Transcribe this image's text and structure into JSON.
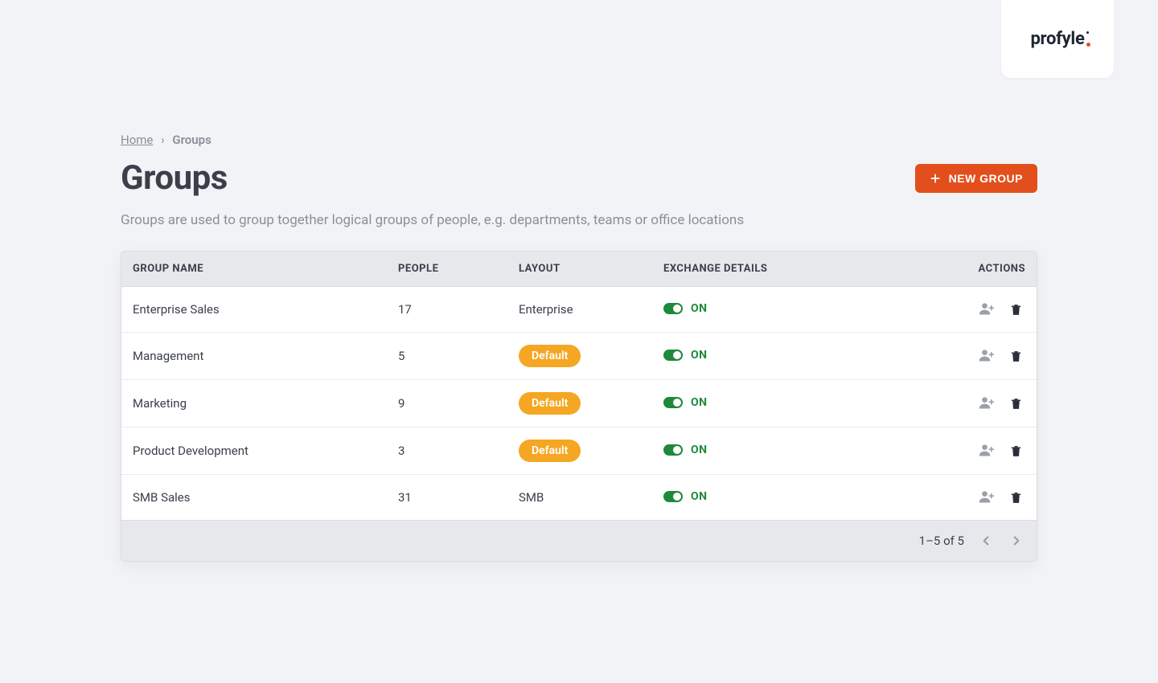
{
  "brand": {
    "name": "profyle"
  },
  "breadcrumb": {
    "home": "Home",
    "separator": "›",
    "current": "Groups"
  },
  "page": {
    "title": "Groups",
    "subtitle": "Groups are used to group together logical groups of people, e.g. departments, teams or office locations"
  },
  "buttons": {
    "new_group": "NEW GROUP"
  },
  "table": {
    "headers": {
      "name": "GROUP NAME",
      "people": "PEOPLE",
      "layout": "LAYOUT",
      "exchange": "EXCHANGE DETAILS",
      "actions": "ACTIONS"
    },
    "default_pill": "Default",
    "exchange_on": "ON",
    "rows": [
      {
        "name": "Enterprise Sales",
        "people": "17",
        "layout": "Enterprise",
        "layout_is_default": false,
        "exchange_on": true
      },
      {
        "name": "Management",
        "people": "5",
        "layout": "Default",
        "layout_is_default": true,
        "exchange_on": true
      },
      {
        "name": "Marketing",
        "people": "9",
        "layout": "Default",
        "layout_is_default": true,
        "exchange_on": true
      },
      {
        "name": "Product Development",
        "people": "3",
        "layout": "Default",
        "layout_is_default": true,
        "exchange_on": true
      },
      {
        "name": "SMB Sales",
        "people": "31",
        "layout": "SMB",
        "layout_is_default": false,
        "exchange_on": true
      }
    ]
  },
  "pagination": {
    "label": "1–5 of 5"
  },
  "colors": {
    "accent": "#e24f1c",
    "pill": "#f5a623",
    "success": "#1d8a3a"
  }
}
